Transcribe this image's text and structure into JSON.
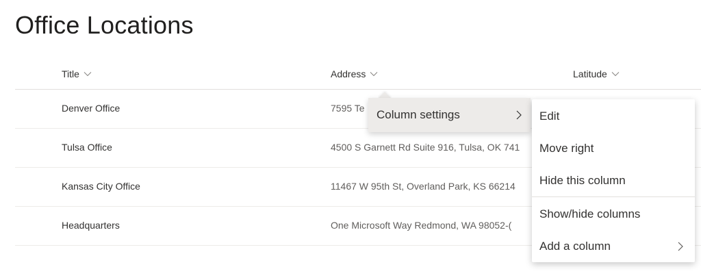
{
  "page": {
    "title": "Office Locations"
  },
  "columns": [
    {
      "label": "Title"
    },
    {
      "label": "Address"
    },
    {
      "label": "Latitude"
    }
  ],
  "rows": [
    {
      "title": "Denver Office",
      "address": "7595 Te"
    },
    {
      "title": "Tulsa Office",
      "address": "4500 S Garnett Rd Suite 916, Tulsa, OK 741"
    },
    {
      "title": "Kansas City Office",
      "address": "11467 W 95th St, Overland Park, KS 66214"
    },
    {
      "title": "Headquarters",
      "address": "One Microsoft Way Redmond, WA 98052-("
    }
  ],
  "column_menu": {
    "settings_label": "Column settings"
  },
  "submenu": {
    "items": [
      {
        "label": "Edit"
      },
      {
        "label": "Move right"
      },
      {
        "label": "Hide this column"
      },
      {
        "label": "Show/hide columns"
      },
      {
        "label": "Add a column"
      }
    ]
  },
  "icons": {
    "column_sort": "chevron-down-icon",
    "submenu_open": "chevron-right-icon"
  },
  "colors": {
    "text_primary": "#323130",
    "text_secondary": "#605e5c",
    "callout_bg": "#edebe9",
    "divider": "#e1dfdd"
  }
}
